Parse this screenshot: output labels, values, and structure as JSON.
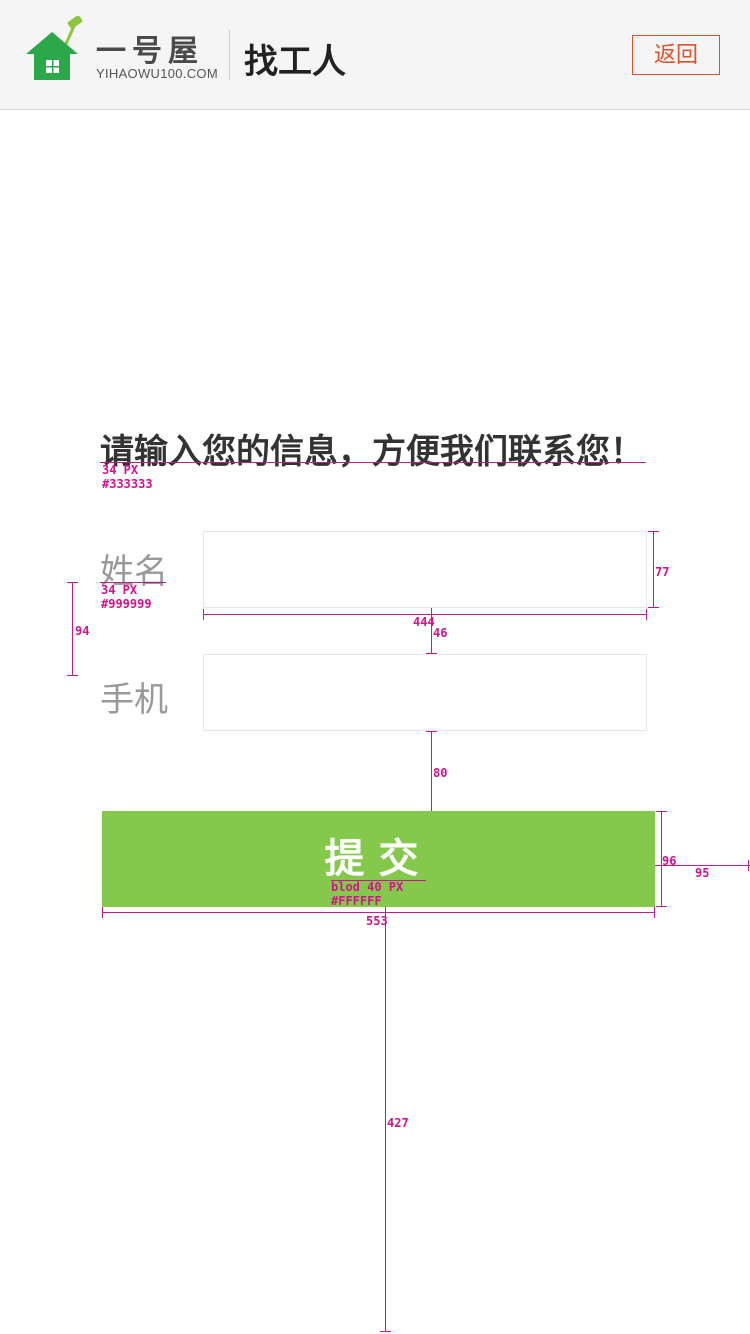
{
  "header": {
    "brand_name": "一号屋",
    "brand_domain": "YIHAOWU100.COM",
    "page_title": "找工人",
    "back_label": "返回",
    "logo_colors": {
      "house": "#2ba84a",
      "roller": "#8cc63f"
    }
  },
  "form": {
    "prompt": "请输入您的信息，方便我们联系您！",
    "name_label": "姓名",
    "name_value": "",
    "phone_label": "手机",
    "phone_value": "",
    "submit_label": "提交"
  },
  "annotations": {
    "prompt_spec_size": "34 PX",
    "prompt_spec_color": "#333333",
    "label_spec_size": "34 PX",
    "label_spec_color": "#999999",
    "label_gap": "94",
    "input_height": "77",
    "input_width": "444",
    "input_gap": "46",
    "button_gap": "80",
    "button_height": "96",
    "button_right_margin": "95",
    "button_spec_weight": "blod 40 PX",
    "button_spec_color": "#FFFFFF",
    "button_width": "553",
    "bottom_space": "427"
  },
  "colors": {
    "accent_green": "#84c94b",
    "back_orange": "#e0512b",
    "annotation_magenta": "#d4128e"
  }
}
